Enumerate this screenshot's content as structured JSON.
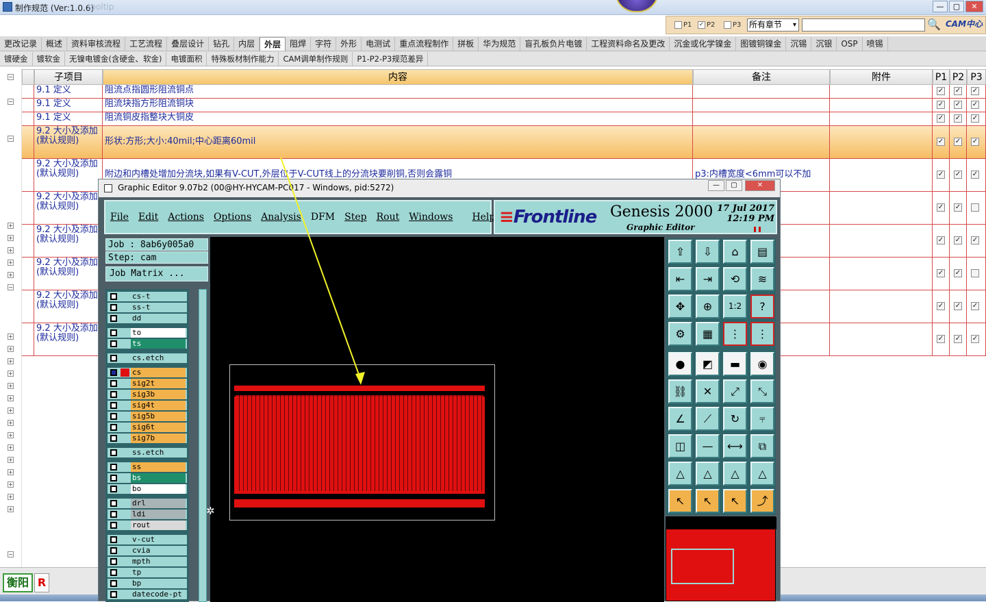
{
  "window": {
    "title": "制作规范 (Ver:1.0.6)",
    "ghost_text": "tooltip"
  },
  "search": {
    "p1": "P1",
    "p2": "P2",
    "p3": "P3",
    "scope": "所有章节",
    "brand": "CAM中心"
  },
  "tabs_row1": [
    "更改记录",
    "概述",
    "资料审核流程",
    "工艺流程",
    "叠层设计",
    "钻孔",
    "内层",
    "外层",
    "阻焊",
    "字符",
    "外形",
    "电测试",
    "重点流程制作",
    "拼板",
    "华为规范",
    "盲孔板负片电镀",
    "工程资料命名及更改",
    "沉金或化学镍金",
    "图镀铜镍金",
    "沉锡",
    "沉银",
    "OSP",
    "喷锡"
  ],
  "tabs_row2": [
    "镀硬金",
    "镀软金",
    "无镍电镀金(含硬金、软金)",
    "电镀面积",
    "特殊板材制作能力",
    "CAM调单制作规则",
    "P1-P2-P3规范差异"
  ],
  "active_tab": "外层",
  "grid": {
    "headers": {
      "sub": "子项目",
      "content": "内容",
      "note": "备注",
      "attach": "附件",
      "p1": "P1",
      "p2": "P2",
      "p3": "P3"
    },
    "rows": [
      {
        "sub": "9.1 定义",
        "content": "阻流点指圆形阻流铜点",
        "note": "",
        "p1": "✓",
        "p2": "✓",
        "p3": "✓"
      },
      {
        "sub": "9.1 定义",
        "content": "阻流块指方形阻流铜块",
        "note": "",
        "p1": "✓",
        "p2": "✓",
        "p3": "✓"
      },
      {
        "sub": "9.1 定义",
        "content": "阻流铜皮指整块大铜皮",
        "note": "",
        "p1": "✓",
        "p2": "✓",
        "p3": "✓"
      },
      {
        "sub": "9.2 大小及添加(默认规则)",
        "content": "形状:方形;大小:40mil;中心距离60mil",
        "note": "",
        "p1": "✓",
        "p2": "✓",
        "p3": "✓"
      },
      {
        "sub": "9.2 大小及添加(默认规则)",
        "content": "附边和内槽处增加分流块,如果有V-CUT,外层位于V-CUT线上的分流块要削铜,否则会露铜",
        "note": "p3:内槽宽度<6mm可以不加",
        "p1": "✓",
        "p2": "✓",
        "p3": "✓"
      },
      {
        "sub": "9.2 大小及添加(默认规则)",
        "content": "",
        "note": "",
        "p1": "✓",
        "p2": "✓",
        "p3": ""
      },
      {
        "sub": "9.2 大小及添加(默认规则)",
        "content": "",
        "note": "",
        "p1": "✓",
        "p2": "✓",
        "p3": "✓"
      },
      {
        "sub": "9.2 大小及添加(默认规则)",
        "content": "",
        "note": "",
        "p1": "✓",
        "p2": "✓",
        "p3": ""
      },
      {
        "sub": "9.2 大小及添加(默认规则)",
        "content": "",
        "note": "",
        "p1": "✓",
        "p2": "✓",
        "p3": "✓"
      },
      {
        "sub": "9.2 大小及添加(默认规则)",
        "content": "",
        "note": "",
        "p1": "✓",
        "p2": "✓",
        "p3": "✓"
      }
    ]
  },
  "footer": {
    "logo": "衡阳",
    "r": "R"
  },
  "genesis": {
    "title": "Graphic Editor 9.07b2 (00@HY-HYCAM-PC017 - Windows, pid:5272)",
    "menu": [
      "File",
      "Edit",
      "Actions",
      "Options",
      "Analysis",
      "DFM",
      "Step",
      "Rout",
      "Windows",
      "Help"
    ],
    "brand": "Frontline",
    "product": "Genesis 2000",
    "subtitle": "Graphic Editor",
    "date": "17 Jul 2017",
    "time": "12:19 PM",
    "job": "Job  : 8ab6y005a0",
    "step": "Step: cam",
    "job_matrix": "Job Matrix ...",
    "layers": [
      "cs-t",
      "ss-t",
      "dd",
      "to",
      "ts",
      "cs.etch",
      "cs",
      "sig2t",
      "sig3b",
      "sig4t",
      "sig5b",
      "sig6t",
      "sig7b",
      "ss.etch",
      "ss",
      "bs",
      "bo",
      "drl",
      "ldi",
      "rout",
      "v-cut",
      "cvia",
      "mpth",
      "tp",
      "bp",
      "datecode-pt"
    ],
    "colors": {
      "panel": "#9fd7d4",
      "copper": "#e01010",
      "layer_highlight": "#f2b24b",
      "green": "#1f8f6b"
    }
  }
}
